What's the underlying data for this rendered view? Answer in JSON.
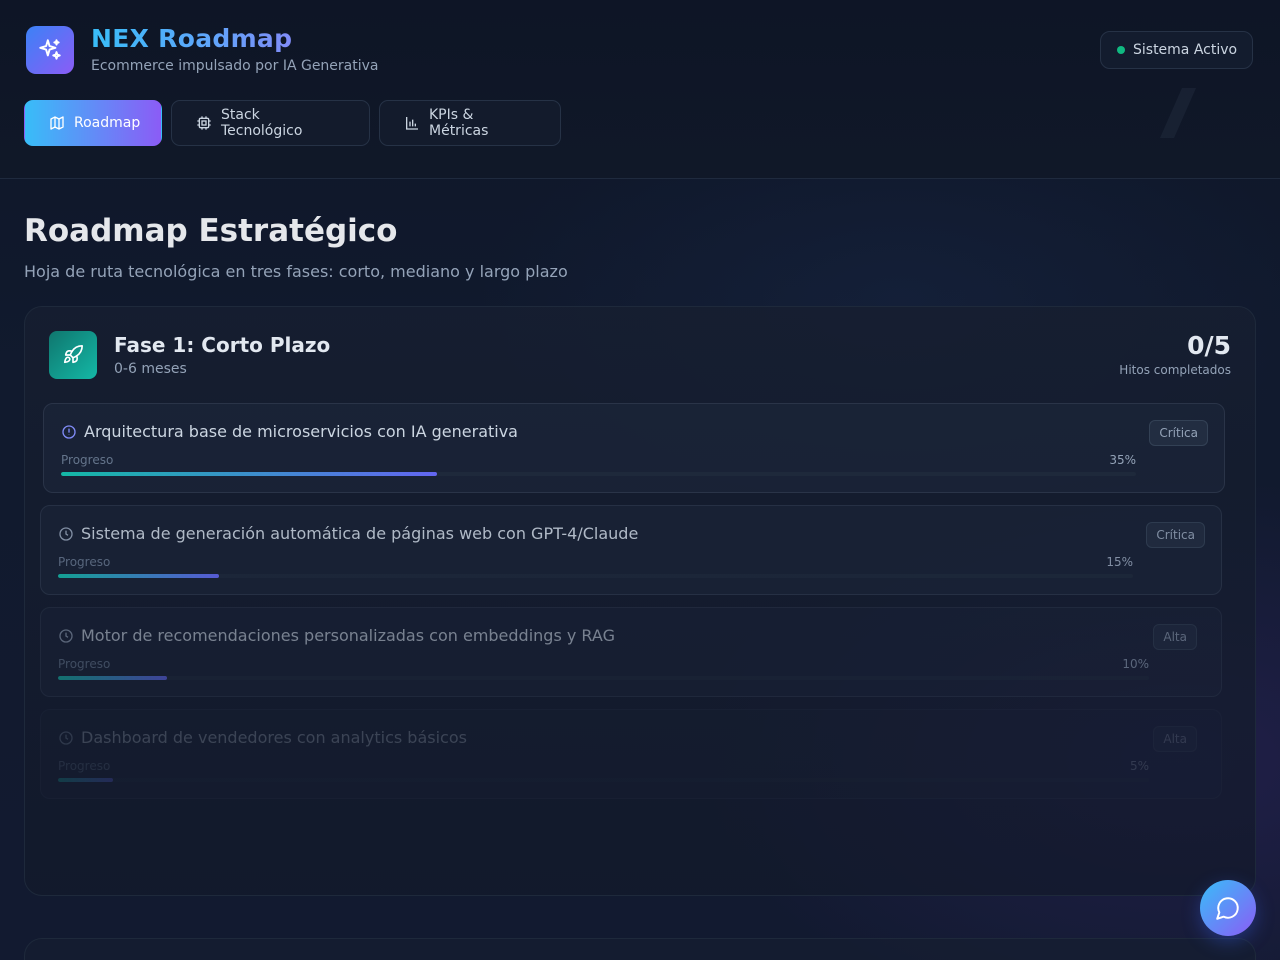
{
  "app": {
    "title": "NEX Roadmap",
    "subtitle": "Ecommerce impulsado por IA Generativa",
    "status": "Sistema Activo",
    "status_color": "#10b981"
  },
  "nav": {
    "tabs": [
      {
        "label": "Roadmap",
        "icon": "map-icon",
        "active": true
      },
      {
        "label": "Stack Tecnológico",
        "icon": "cpu-icon",
        "active": false
      },
      {
        "label": "KPIs & Métricas",
        "icon": "bar-chart-icon",
        "active": false
      }
    ]
  },
  "main": {
    "title": "Roadmap Estratégico",
    "subtitle": "Hoja de ruta tecnológica en tres fases: corto, mediano y largo plazo"
  },
  "phase": {
    "title": "Fase 1: Corto Plazo",
    "range": "0-6 meses",
    "count": "0/5",
    "count_label": "Hitos completados",
    "icon": "rocket-icon",
    "milestones": [
      {
        "title": "Arquitectura base de microservicios con IA generativa",
        "priority": "Crítica",
        "progress_label": "Progreso",
        "progress_text": "35%",
        "progress": 35,
        "icon": "info-circle-icon"
      },
      {
        "title": "Sistema de generación automática de páginas web con GPT-4/Claude",
        "priority": "Crítica",
        "progress_label": "Progreso",
        "progress_text": "15%",
        "progress": 15,
        "icon": "clock-icon"
      },
      {
        "title": "Motor de recomendaciones personalizadas con embeddings y RAG",
        "priority": "Alta",
        "progress_label": "Progreso",
        "progress_text": "10%",
        "progress": 10,
        "icon": "clock-icon"
      },
      {
        "title": "Dashboard de vendedores con analytics básicos",
        "priority": "Alta",
        "progress_label": "Progreso",
        "progress_text": "5%",
        "progress": 5,
        "icon": "clock-icon"
      }
    ]
  },
  "chat": {
    "icon": "chat-bubble-icon"
  }
}
